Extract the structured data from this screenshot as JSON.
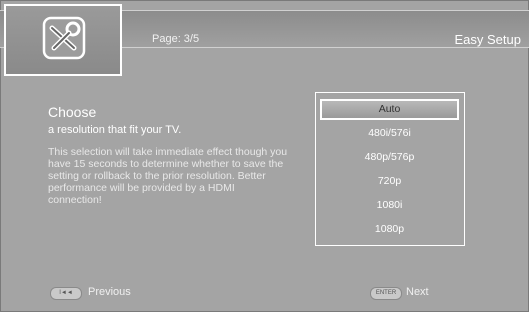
{
  "header": {
    "page_label": "Page: 3/5",
    "title": "Easy Setup",
    "icon": "wrench-screwdriver-icon"
  },
  "main": {
    "heading": "Choose",
    "subheading": "a resolution that fit your TV.",
    "description": "This selection will take immediate effect though you have 15 seconds to determine whether to save the setting or rollback to the prior resolution. Better performance will be provided by a HDMI connection!"
  },
  "resolution_options": [
    "Auto",
    "480i/576i",
    "480p/576p",
    "720p",
    "1080i",
    "1080p"
  ],
  "selected_option": "Auto",
  "footer": {
    "previous_key": "I◄◄",
    "previous_label": "Previous",
    "next_key": "ENTER",
    "next_label": "Next"
  }
}
